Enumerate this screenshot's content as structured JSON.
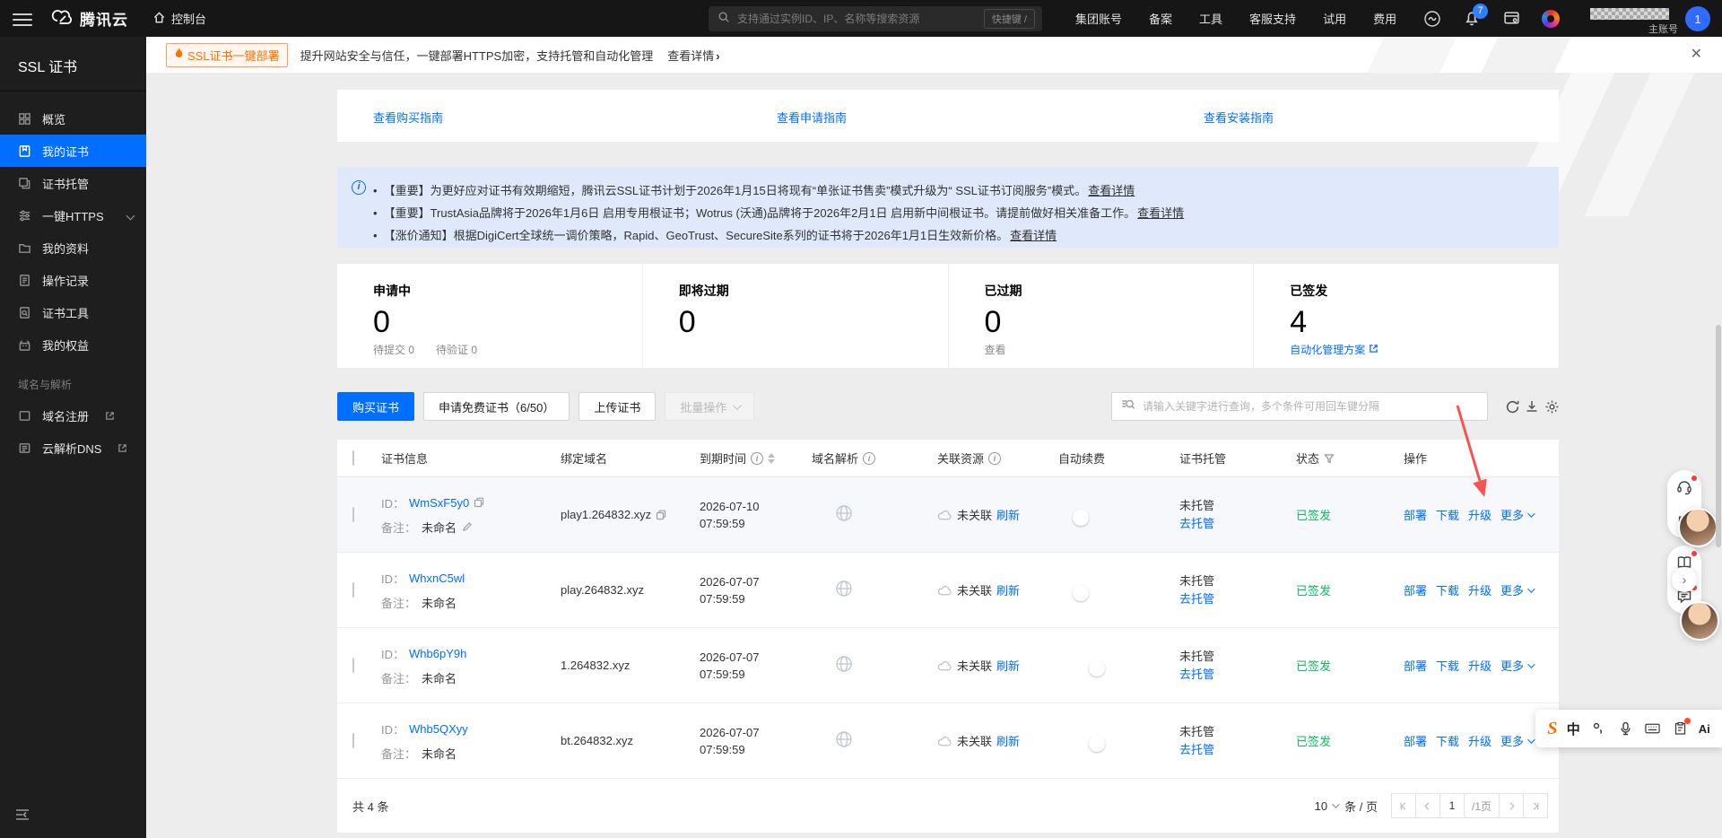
{
  "header": {
    "brand": "腾讯云",
    "console": "控制台",
    "search_placeholder": "支持通过实例ID、IP、名称等搜索资源",
    "shortcut": "快捷键 /",
    "nav": [
      "集团账号",
      "备案",
      "工具",
      "客服支持",
      "试用",
      "费用"
    ],
    "bell_badge": "7",
    "account_label": "主账号",
    "avatar_text": "1"
  },
  "sidebar": {
    "title": "SSL 证书",
    "items": [
      {
        "label": "概览"
      },
      {
        "label": "我的证书"
      },
      {
        "label": "证书托管"
      },
      {
        "label": "一键HTTPS"
      },
      {
        "label": "我的资料"
      },
      {
        "label": "操作记录"
      },
      {
        "label": "证书工具"
      },
      {
        "label": "我的权益"
      }
    ],
    "section": "域名与解析",
    "external": [
      {
        "label": "域名注册"
      },
      {
        "label": "云解析DNS"
      }
    ]
  },
  "banner": {
    "badge": "SSL证书一键部署",
    "text": "提升网站安全与信任，一键部署HTTPS加密，支持托管和自动化管理",
    "link": "查看详情"
  },
  "guide": {
    "links": [
      "查看购买指南",
      "查看申请指南",
      "查看安装指南"
    ]
  },
  "notices": [
    {
      "text": "【重要】为更好应对证书有效期缩短，腾讯云SSL证书计划于2026年1月15日将现有“单张证书售卖”模式升级为“ SSL证书订阅服务”模式。",
      "link": "查看详情"
    },
    {
      "text": "【重要】TrustAsia品牌将于2026年1月6日 启用专用根证书；Wotrus (沃通)品牌将于2026年2月1日 启用新中间根证书。请提前做好相关准备工作。",
      "link": "查看详情"
    },
    {
      "text": "【涨价通知】根据DigiCert全球统一调价策略，Rapid、GeoTrust、SecureSite系列的证书将于2026年1月1日生效新价格。",
      "link": "查看详情"
    }
  ],
  "stats": {
    "cards": [
      {
        "label": "申请中",
        "value": "0",
        "sub1": "待提交 0",
        "sub2": "待验证 0"
      },
      {
        "label": "即将过期",
        "value": "0"
      },
      {
        "label": "已过期",
        "value": "0",
        "action": "查看"
      },
      {
        "label": "已签发",
        "value": "4",
        "action": "自动化管理方案"
      }
    ]
  },
  "toolbar": {
    "buy": "购买证书",
    "free": "申请免费证书（6/50）",
    "upload": "上传证书",
    "batch": "批量操作",
    "search_placeholder": "请输入关键字进行查询，多个条件可用回车键分隔"
  },
  "table": {
    "headers": [
      "证书信息",
      "绑定域名",
      "到期时间",
      "域名解析",
      "关联资源",
      "自动续费",
      "证书托管",
      "状态",
      "操作"
    ],
    "labels": {
      "id": "ID：",
      "remark": "备注：",
      "remark_value": "未命名",
      "unlinked": "未关联",
      "refresh": "刷新",
      "unhosted": "未托管",
      "to_host": "去托管",
      "status": "已签发",
      "deploy": "部署",
      "download": "下载",
      "upgrade": "升级",
      "more": "更多"
    },
    "rows": [
      {
        "id": "WmSxF5y0",
        "domain": "play1.264832.xyz",
        "date": "2026-07-10",
        "time": "07:59:59",
        "auto_renew": false
      },
      {
        "id": "WhxnC5wl",
        "domain": "play.264832.xyz",
        "date": "2026-07-07",
        "time": "07:59:59",
        "auto_renew": false
      },
      {
        "id": "Whb6pY9h",
        "domain": "1.264832.xyz",
        "date": "2026-07-07",
        "time": "07:59:59",
        "auto_renew": true
      },
      {
        "id": "Whb5QXyy",
        "domain": "bt.264832.xyz",
        "date": "2026-07-07",
        "time": "07:59:59",
        "auto_renew": true
      }
    ]
  },
  "pagination": {
    "total": "共 4 条",
    "page_size": "10",
    "unit": "条 / 页",
    "current": "1",
    "total_pages": "/1页"
  },
  "ime": {
    "lang": "中",
    "ai": "Ai"
  },
  "colors": {
    "accent": "#006eff",
    "success": "#0abf5b",
    "arrow_red": "#fa5151",
    "notice_bg": "#dfe9fb",
    "topbar": "#161616"
  }
}
